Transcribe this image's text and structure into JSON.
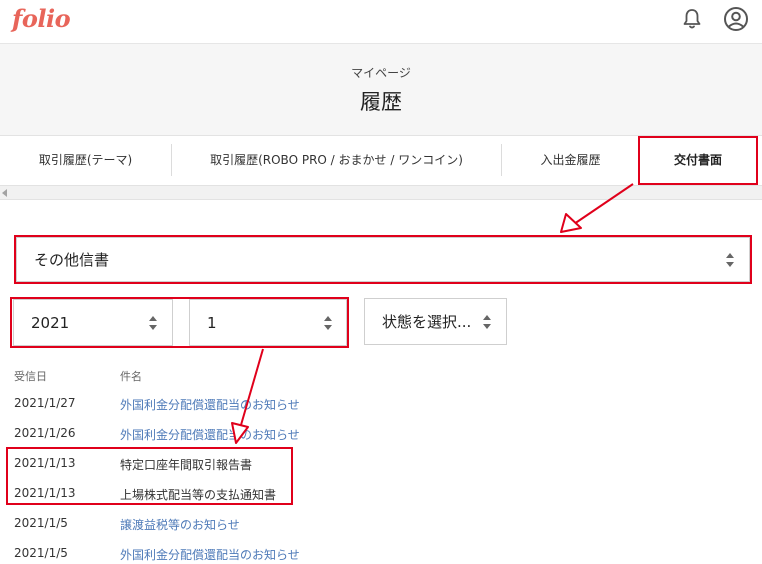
{
  "app": {
    "logo": "folio"
  },
  "header": {
    "subtitle": "マイページ",
    "title": "履歴"
  },
  "tabs": [
    {
      "label": "取引履歴(テーマ)"
    },
    {
      "label": "取引履歴(ROBO PRO / おまかせ / ワンコイン)"
    },
    {
      "label": "入出金履歴"
    },
    {
      "label": "交付書面"
    }
  ],
  "filters": {
    "document_type": "その他信書",
    "year": "2021",
    "month": "1",
    "status": "状態を選択..."
  },
  "list": {
    "columns": [
      "受信日",
      "件名"
    ],
    "rows": [
      {
        "date": "2021/1/27",
        "subject": "外国利金分配償還配当のお知らせ"
      },
      {
        "date": "2021/1/26",
        "subject": "外国利金分配償還配当のお知らせ"
      },
      {
        "date": "2021/1/13",
        "subject": "特定口座年間取引報告書"
      },
      {
        "date": "2021/1/13",
        "subject": "上場株式配当等の支払通知書"
      },
      {
        "date": "2021/1/5",
        "subject": "譲渡益税等のお知らせ"
      },
      {
        "date": "2021/1/5",
        "subject": "外国利金分配償還配当のお知らせ"
      }
    ]
  },
  "colors": {
    "brand": "#e8655a",
    "link": "#4e7ab8",
    "annotation": "#e0001b"
  },
  "icons": {
    "notification": "bell-icon",
    "account": "user-circle-icon"
  }
}
